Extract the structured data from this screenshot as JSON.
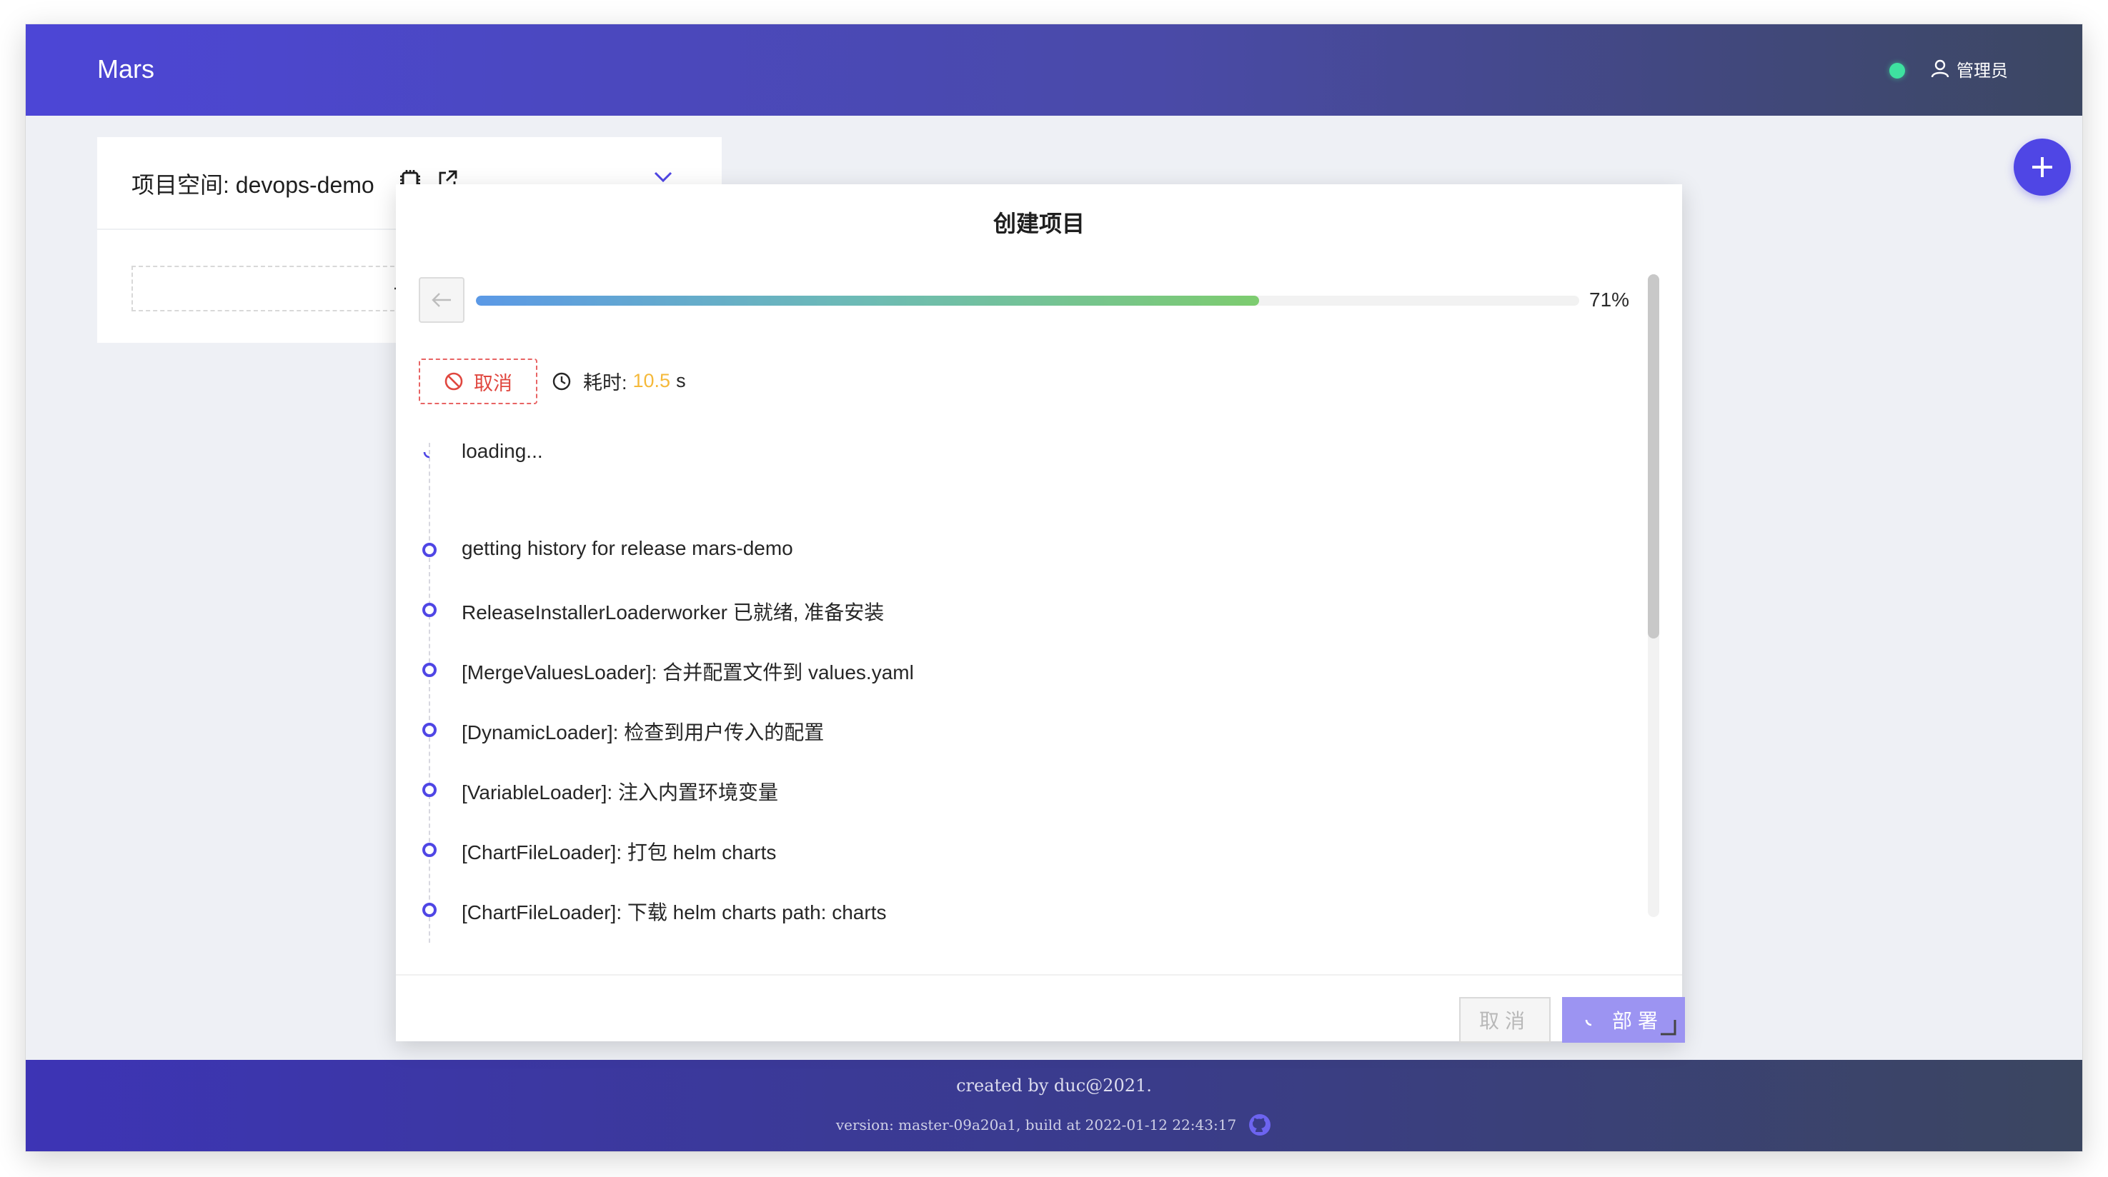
{
  "header": {
    "app_title": "Mars",
    "user_label": "管理员",
    "status_color": "#3ee2a0"
  },
  "project_card": {
    "title_prefix": "项目空间: ",
    "namespace": "devops-demo",
    "add_symbol": "+"
  },
  "fab": {
    "symbol": "+"
  },
  "modal": {
    "title": "创建项目",
    "progress": {
      "percent": 71,
      "label": "71%"
    },
    "cancel_label": "取消",
    "elapsed_label": "耗时:",
    "elapsed_value": "10.5",
    "elapsed_unit": "s",
    "timeline": [
      {
        "text": "loading...",
        "state": "loading"
      },
      {
        "text": "getting history for release mars-demo",
        "state": "done"
      },
      {
        "text": "ReleaseInstallerLoaderworker 已就绪, 准备安装",
        "state": "done"
      },
      {
        "text": "[MergeValuesLoader]: 合并配置文件到 values.yaml",
        "state": "done"
      },
      {
        "text": "[DynamicLoader]: 检查到用户传入的配置",
        "state": "done"
      },
      {
        "text": "[VariableLoader]: 注入内置环境变量",
        "state": "done"
      },
      {
        "text": "[ChartFileLoader]: 打包 helm charts",
        "state": "done"
      },
      {
        "text": "[ChartFileLoader]: 下载 helm charts path: charts",
        "state": "done"
      }
    ],
    "footer": {
      "cancel_label": "取消",
      "deploy_label": "部署"
    }
  },
  "footer": {
    "created": "created by duc@2021.",
    "version": "version: master-09a20a1, build at 2022-01-12 22:43:17"
  },
  "colors": {
    "accent": "#4f46e5",
    "danger": "#e0473f",
    "elapsed": "#f5b93a"
  },
  "icons": {
    "back": "arrow-left-icon",
    "cancel": "stop-icon",
    "clock": "clock-icon",
    "user": "user-icon",
    "github": "github-icon"
  }
}
